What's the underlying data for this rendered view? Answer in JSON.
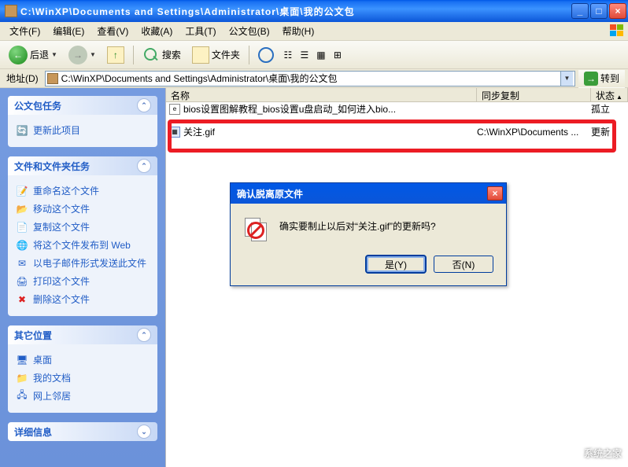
{
  "titlebar": {
    "title": "C:\\WinXP\\Documents and Settings\\Administrator\\桌面\\我的公文包"
  },
  "menu": {
    "file": "文件(F)",
    "edit": "编辑(E)",
    "view": "查看(V)",
    "favorites": "收藏(A)",
    "tools": "工具(T)",
    "briefcase": "公文包(B)",
    "help": "帮助(H)"
  },
  "toolbar": {
    "back": "后退",
    "search": "搜索",
    "folders": "文件夹"
  },
  "addressbar": {
    "label": "地址(D)",
    "path": "C:\\WinXP\\Documents and Settings\\Administrator\\桌面\\我的公文包",
    "go": "转到"
  },
  "columns": {
    "name": "名称",
    "sync": "同步复制",
    "status": "状态"
  },
  "rows": [
    {
      "name": "bios设置图解教程_bios设置u盘启动_如何进入bio...",
      "sync": "",
      "status": "孤立"
    },
    {
      "name": "关注.gif",
      "sync": "C:\\WinXP\\Documents ...",
      "status": "更新"
    }
  ],
  "tasks": {
    "briefcase_header": "公文包任务",
    "update_item": "更新此项目",
    "file_header": "文件和文件夹任务",
    "rename": "重命名这个文件",
    "move": "移动这个文件",
    "copy": "复制这个文件",
    "publish": "将这个文件发布到 Web",
    "email": "以电子邮件形式发送此文件",
    "print": "打印这个文件",
    "delete": "删除这个文件",
    "other_header": "其它位置",
    "desktop": "桌面",
    "mydocs": "我的文档",
    "network": "网上邻居",
    "details_header": "详细信息"
  },
  "dialog": {
    "title": "确认脱离原文件",
    "message": "确实要制止以后对“关注.gif”的更新吗?",
    "yes": "是(Y)",
    "no": "否(N)"
  },
  "watermark": "系统之家"
}
